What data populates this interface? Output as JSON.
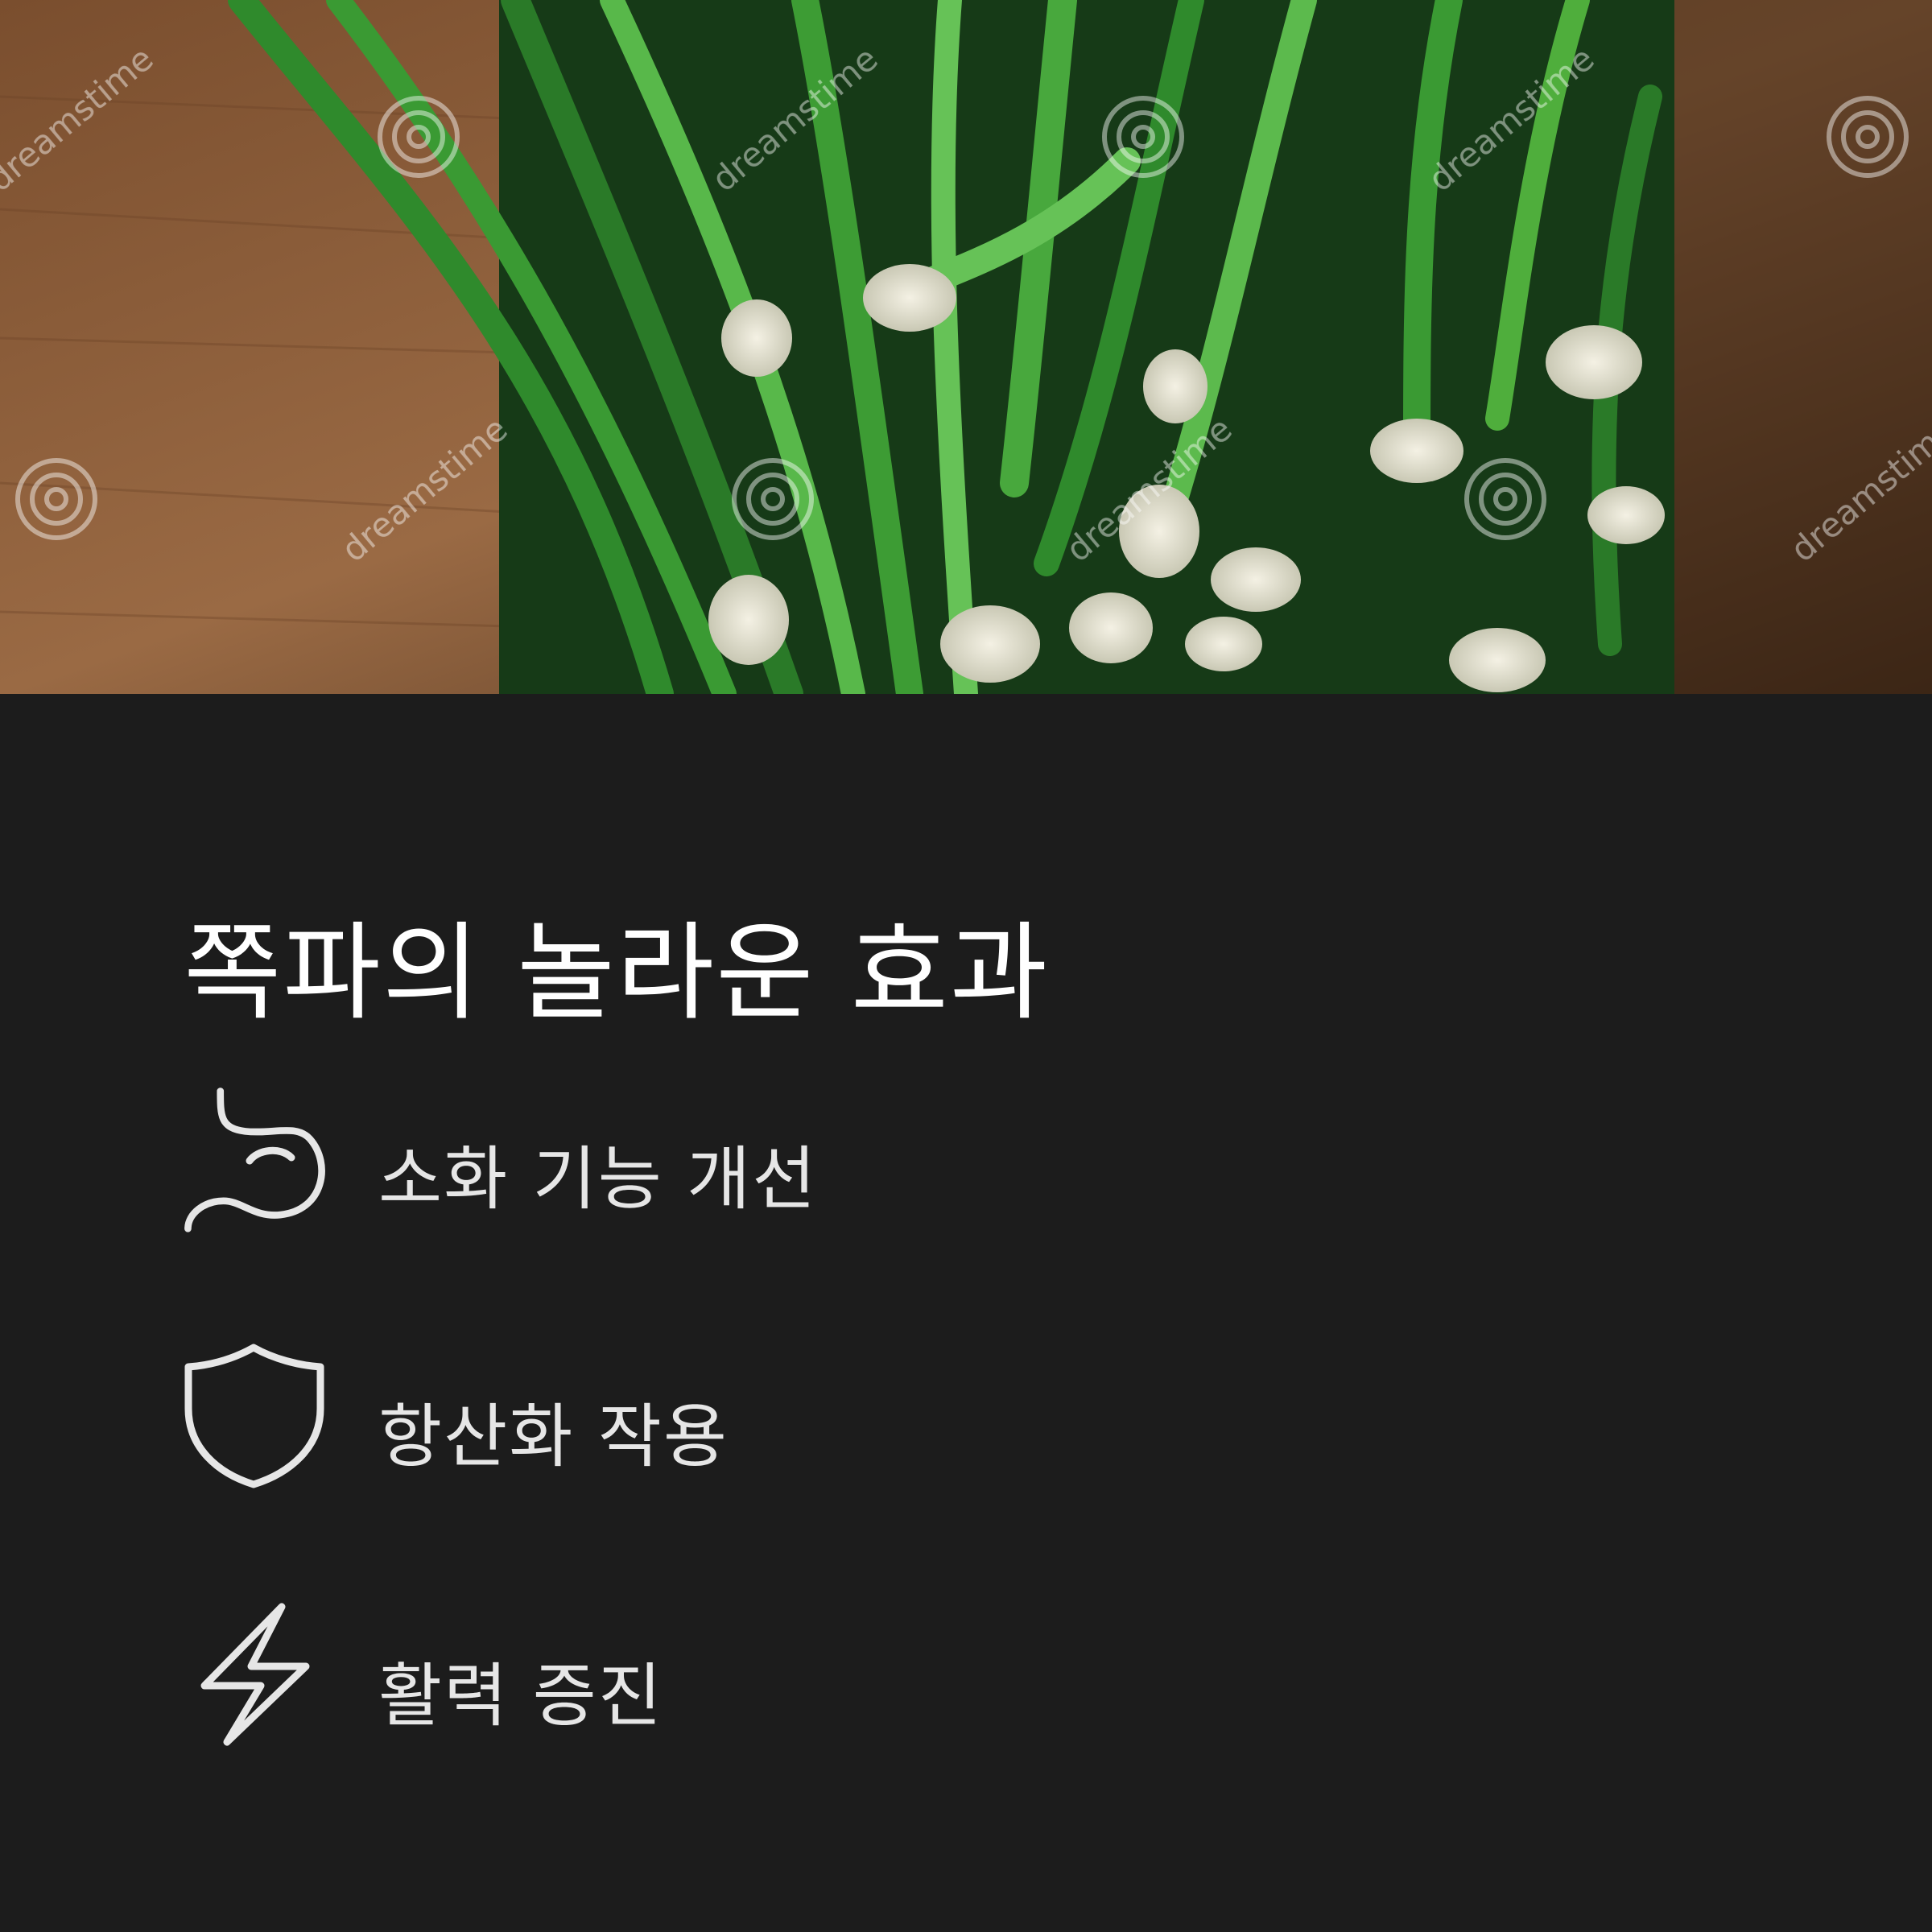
{
  "hero": {
    "image": "green-onion-bunch-photo",
    "watermark": "dreamstime"
  },
  "title": "쪽파의 놀라운 효과",
  "benefits": [
    {
      "icon": "stomach-icon",
      "label": "소화 기능 개선"
    },
    {
      "icon": "shield-icon",
      "label": "항산화 작용"
    },
    {
      "icon": "lightning-icon",
      "label": "활력 증진"
    }
  ],
  "colors": {
    "background": "#1c1c1c",
    "title": "#ffffff",
    "label": "#e6e6e6",
    "icon": "#e6e6e6"
  }
}
